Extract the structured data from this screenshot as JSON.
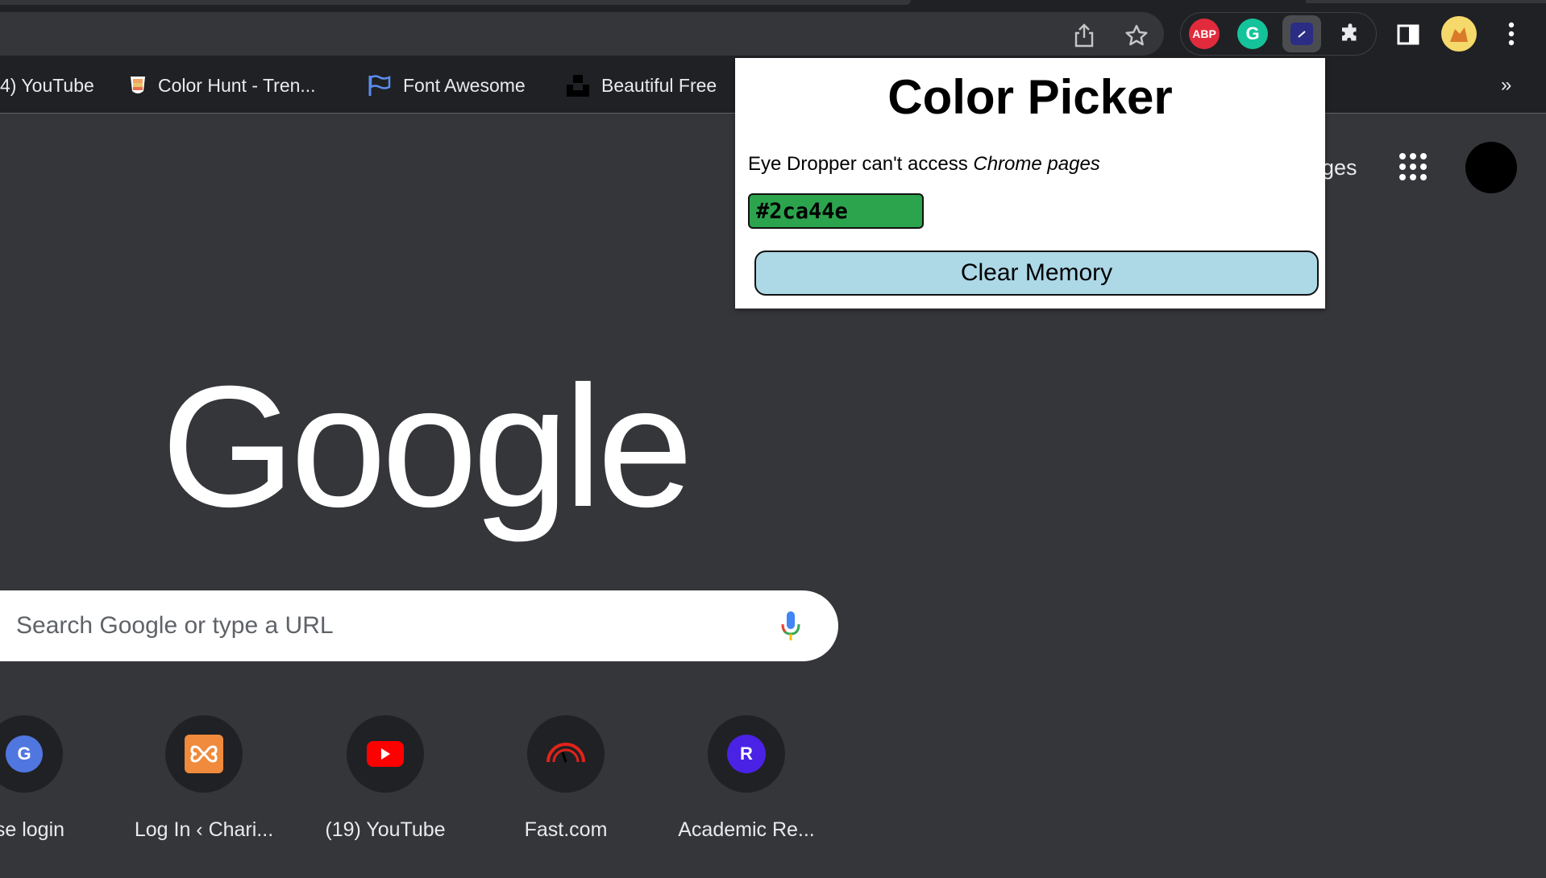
{
  "toolbar": {
    "share_icon": "share-icon",
    "star_icon": "star-icon",
    "extensions": [
      {
        "name": "adblock-plus-icon",
        "label": "ABP",
        "color": "#e12b3c"
      },
      {
        "name": "grammarly-icon",
        "label": "G",
        "color": "#15c39a"
      },
      {
        "name": "color-picker-extension-icon",
        "color": "#2b2d84"
      }
    ],
    "puzzle_icon": "puzzle-icon",
    "sidepanel_icon": "side-panel-icon",
    "menu_icon": "kebab-menu-icon"
  },
  "bookmarks": {
    "items": [
      {
        "label": "4) YouTube"
      },
      {
        "label": "Color Hunt - Tren..."
      },
      {
        "label": "Font Awesome"
      },
      {
        "label": "Beautiful Free"
      }
    ],
    "overflow": "»"
  },
  "popup": {
    "title": "Color Picker",
    "message_prefix": "Eye Dropper can't access ",
    "message_emph": "Chrome pages",
    "color_value": "#2ca44e",
    "clear_button": "Clear Memory"
  },
  "ntp": {
    "images_link": "ges",
    "logo": "Google",
    "search_placeholder": "Search Google or type a URL",
    "shortcuts": [
      {
        "label": "ase login",
        "icon_letter": "G",
        "color": "#5076e0"
      },
      {
        "label": "Log In ‹ Chari...",
        "icon_letter": "",
        "color": "#f08a3c"
      },
      {
        "label": "(19) YouTube",
        "icon_letter": "",
        "color": "#ff0000"
      },
      {
        "label": "Fast.com",
        "icon_letter": "",
        "color": "#e2231a"
      },
      {
        "label": "Academic Re...",
        "icon_letter": "R",
        "color": "#4a22e6"
      }
    ]
  }
}
